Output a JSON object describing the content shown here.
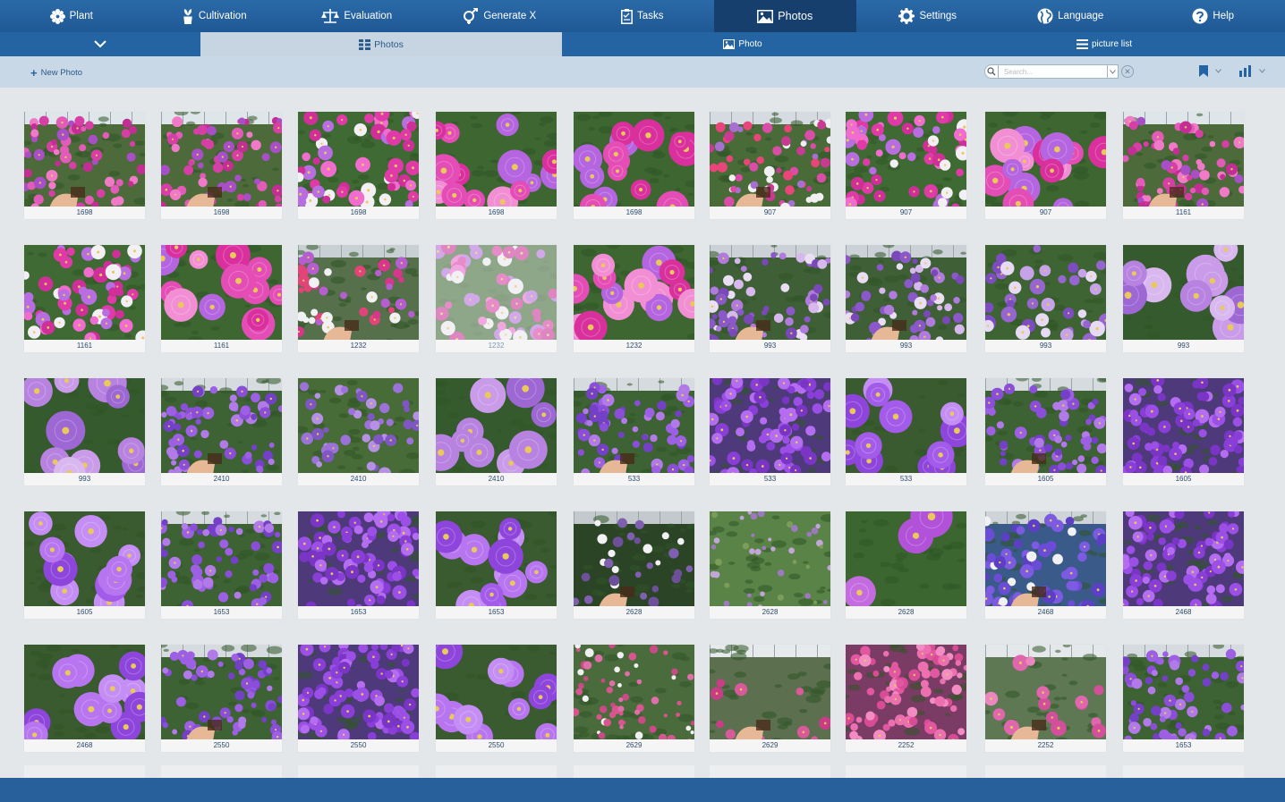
{
  "top_nav": [
    {
      "label": "Plant",
      "icon": "gear-flower-icon"
    },
    {
      "label": "Cultivation",
      "icon": "potted-plant-icon"
    },
    {
      "label": "Evaluation",
      "icon": "scales-icon"
    },
    {
      "label": "Generate X",
      "icon": "gender-icon"
    },
    {
      "label": "Tasks",
      "icon": "clipboard-icon"
    },
    {
      "label": "Photos",
      "icon": "picture-icon",
      "active": true
    },
    {
      "label": "Settings",
      "icon": "gear-icon"
    },
    {
      "label": "Language",
      "icon": "globe-icon"
    },
    {
      "label": "Help",
      "icon": "question-icon"
    }
  ],
  "sub_nav": {
    "photos_label": "Photos",
    "photo_label": "Photo",
    "list_label": "picture list"
  },
  "toolbar": {
    "new_photo_label": "New Photo",
    "search_placeholder": "Search..."
  },
  "colors": {
    "nav_bg": "#2564a2",
    "nav_active": "#163f6d",
    "accent": "#2c5a8a"
  },
  "photos": [
    {
      "caption": "1698",
      "palette": "magenta-field",
      "hand": true
    },
    {
      "caption": "1698",
      "palette": "magenta-field",
      "hand": true
    },
    {
      "caption": "1698",
      "palette": "magenta-mix"
    },
    {
      "caption": "1698",
      "palette": "magenta-close"
    },
    {
      "caption": "1698",
      "palette": "magenta-close"
    },
    {
      "caption": "907",
      "palette": "pink-field",
      "hand": true
    },
    {
      "caption": "907",
      "palette": "magenta-mix"
    },
    {
      "caption": "907",
      "palette": "magenta-close"
    },
    {
      "caption": "1161",
      "palette": "magenta-field",
      "hand": true
    },
    {
      "caption": "1161",
      "palette": "magenta-mix"
    },
    {
      "caption": "1161",
      "palette": "magenta-close"
    },
    {
      "caption": "1232",
      "palette": "greenhouse",
      "hand": true
    },
    {
      "caption": "1232",
      "palette": "magenta-mix",
      "faded": true
    },
    {
      "caption": "1232",
      "palette": "magenta-close"
    },
    {
      "caption": "993",
      "palette": "lilac-field",
      "hand": true
    },
    {
      "caption": "993",
      "palette": "lilac-field",
      "hand": true
    },
    {
      "caption": "993",
      "palette": "lilac-mix"
    },
    {
      "caption": "993",
      "palette": "lilac-close"
    },
    {
      "caption": "993",
      "palette": "lilac-close"
    },
    {
      "caption": "2410",
      "palette": "violet-field",
      "hand": true
    },
    {
      "caption": "2410",
      "palette": "violet-green"
    },
    {
      "caption": "2410",
      "palette": "lilac-close"
    },
    {
      "caption": "533",
      "palette": "violet-field",
      "hand": true
    },
    {
      "caption": "533",
      "palette": "violet-dense"
    },
    {
      "caption": "533",
      "palette": "violet-close"
    },
    {
      "caption": "1605",
      "palette": "violet-field",
      "hand": true
    },
    {
      "caption": "1605",
      "palette": "violet-dense"
    },
    {
      "caption": "1605",
      "palette": "violet-close"
    },
    {
      "caption": "1653",
      "palette": "violet-field"
    },
    {
      "caption": "1653",
      "palette": "violet-dense"
    },
    {
      "caption": "1653",
      "palette": "violet-close"
    },
    {
      "caption": "2628",
      "palette": "dark-green",
      "hand": true
    },
    {
      "caption": "2628",
      "palette": "green-field"
    },
    {
      "caption": "2628",
      "palette": "violet-single"
    },
    {
      "caption": "2468",
      "palette": "blue-violet",
      "hand": true
    },
    {
      "caption": "2468",
      "palette": "violet-dense"
    },
    {
      "caption": "2468",
      "palette": "violet-close"
    },
    {
      "caption": "2550",
      "palette": "violet-field",
      "hand": true
    },
    {
      "caption": "2550",
      "palette": "violet-dense"
    },
    {
      "caption": "2550",
      "palette": "violet-close"
    },
    {
      "caption": "2629",
      "palette": "pink-greenhouse"
    },
    {
      "caption": "2629",
      "palette": "greenhouse-pot",
      "hand": true
    },
    {
      "caption": "2252",
      "palette": "pink-dense"
    },
    {
      "caption": "2252",
      "palette": "pink-pot",
      "hand": true
    },
    {
      "caption": "1653",
      "palette": "violet-field"
    }
  ]
}
